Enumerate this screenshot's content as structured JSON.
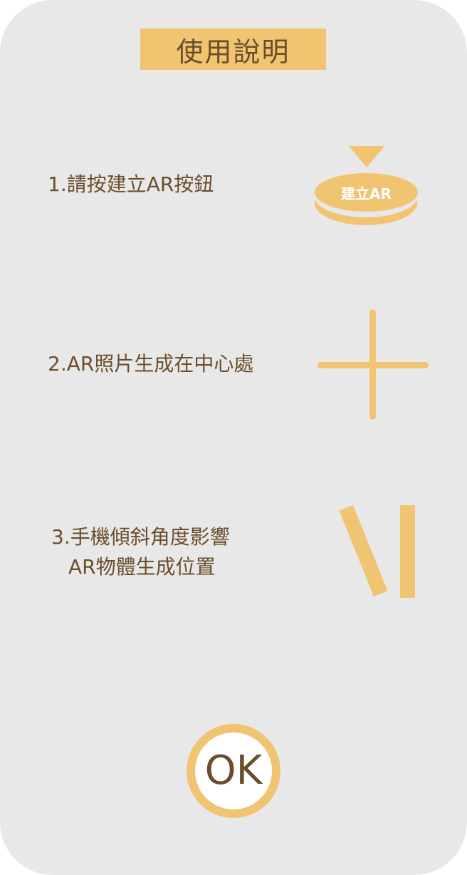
{
  "dialog": {
    "title": "使用說明"
  },
  "steps": [
    {
      "text": "1.請按建立AR按鈕"
    },
    {
      "text": "2.AR照片生成在中心處"
    },
    {
      "line1": "3.手機傾斜角度影響",
      "line2": "AR物體生成位置"
    }
  ],
  "illustrations": {
    "ar_button_label": "建立AR",
    "step1_icon": "pointer-arrow-icon",
    "step2_icon": "crosshair-icon",
    "step3_icon": "tilt-bars-icon"
  },
  "ok_button": {
    "label": "OK"
  },
  "colors": {
    "background": "#e9e8e9",
    "accent": "#f1c472",
    "text": "#6a4e2c",
    "white": "#ffffff"
  }
}
